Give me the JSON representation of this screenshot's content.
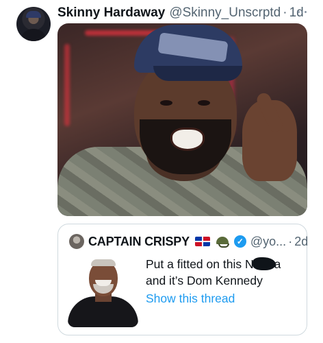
{
  "tweet": {
    "display_name": "Skinny Hardaway",
    "handle": "@Skinny_Unscrptd",
    "separator": "·",
    "time": "1d"
  },
  "quoted": {
    "display_name": "CAPTAIN CRISPY",
    "handle": "@yo...",
    "separator": "·",
    "time": "2d",
    "text_line1_a": "Put a fitted on this N",
    "text_line1_b": "a",
    "text_line2": "and it’s Dom Kennedy",
    "show_thread": "Show this thread"
  },
  "colors": {
    "text_primary": "#0f1419",
    "text_secondary": "#536471",
    "link": "#1d9bf0",
    "border": "#cfd9de"
  },
  "icons": {
    "more": "ellipsis-icon",
    "flag": "dominican-flag-icon",
    "helmet": "military-helmet-icon",
    "verified": "verified-badge-icon"
  }
}
